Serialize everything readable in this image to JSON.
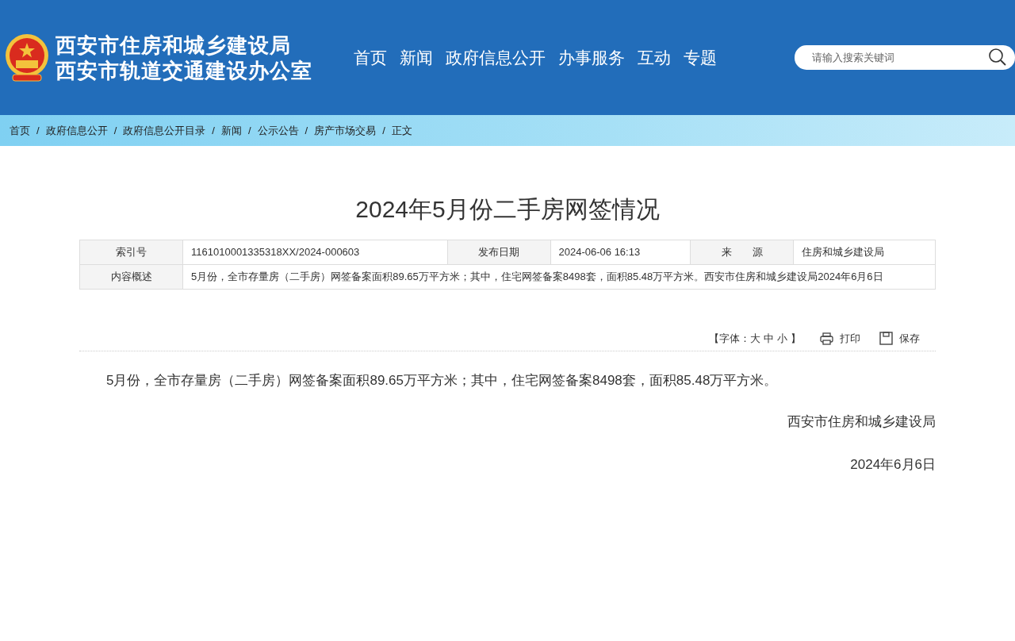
{
  "header": {
    "site_titles": [
      "西安市住房和城乡建设局",
      "西安市轨道交通建设办公室"
    ],
    "nav": [
      {
        "label": "首页"
      },
      {
        "label": "新闻"
      },
      {
        "label": "政府信息公开"
      },
      {
        "label": "办事服务"
      },
      {
        "label": "互动"
      },
      {
        "label": "专题"
      }
    ],
    "search": {
      "placeholder": "请输入搜索关键词"
    }
  },
  "breadcrumb": {
    "separator": "/",
    "items": [
      "首页",
      "政府信息公开",
      "政府信息公开目录",
      "新闻",
      "公示公告",
      "房产市场交易",
      "正文"
    ]
  },
  "article": {
    "title": "2024年5月份二手房网签情况",
    "meta_rows": [
      [
        {
          "label": "索引号",
          "value": "1161010001335318XX/2024-000603"
        },
        {
          "label": "发布日期",
          "value": "2024-06-06 16:13"
        },
        {
          "label": "来　　源",
          "value": "住房和城乡建设局"
        }
      ],
      [
        {
          "label": "内容概述",
          "value": "5月份，全市存量房（二手房）网签备案面积89.65万平方米；其中，住宅网签备案8498套，面积85.48万平方米。西安市住房和城乡建设局2024年6月6日"
        }
      ]
    ],
    "tools": {
      "font_size_prefix": "【字体：",
      "font_sizes": [
        "大",
        "中",
        "小"
      ],
      "font_size_suffix": "】",
      "actions": [
        {
          "kind": "print",
          "label": "打印"
        },
        {
          "kind": "save",
          "label": "保存"
        }
      ]
    },
    "paragraphs": [
      "5月份，全市存量房（二手房）网签备案面积89.65万平方米；其中，住宅网签备案8498套，面积85.48万平方米。"
    ],
    "signature": "西安市住房和城乡建设局",
    "date": "2024年6月6日"
  }
}
